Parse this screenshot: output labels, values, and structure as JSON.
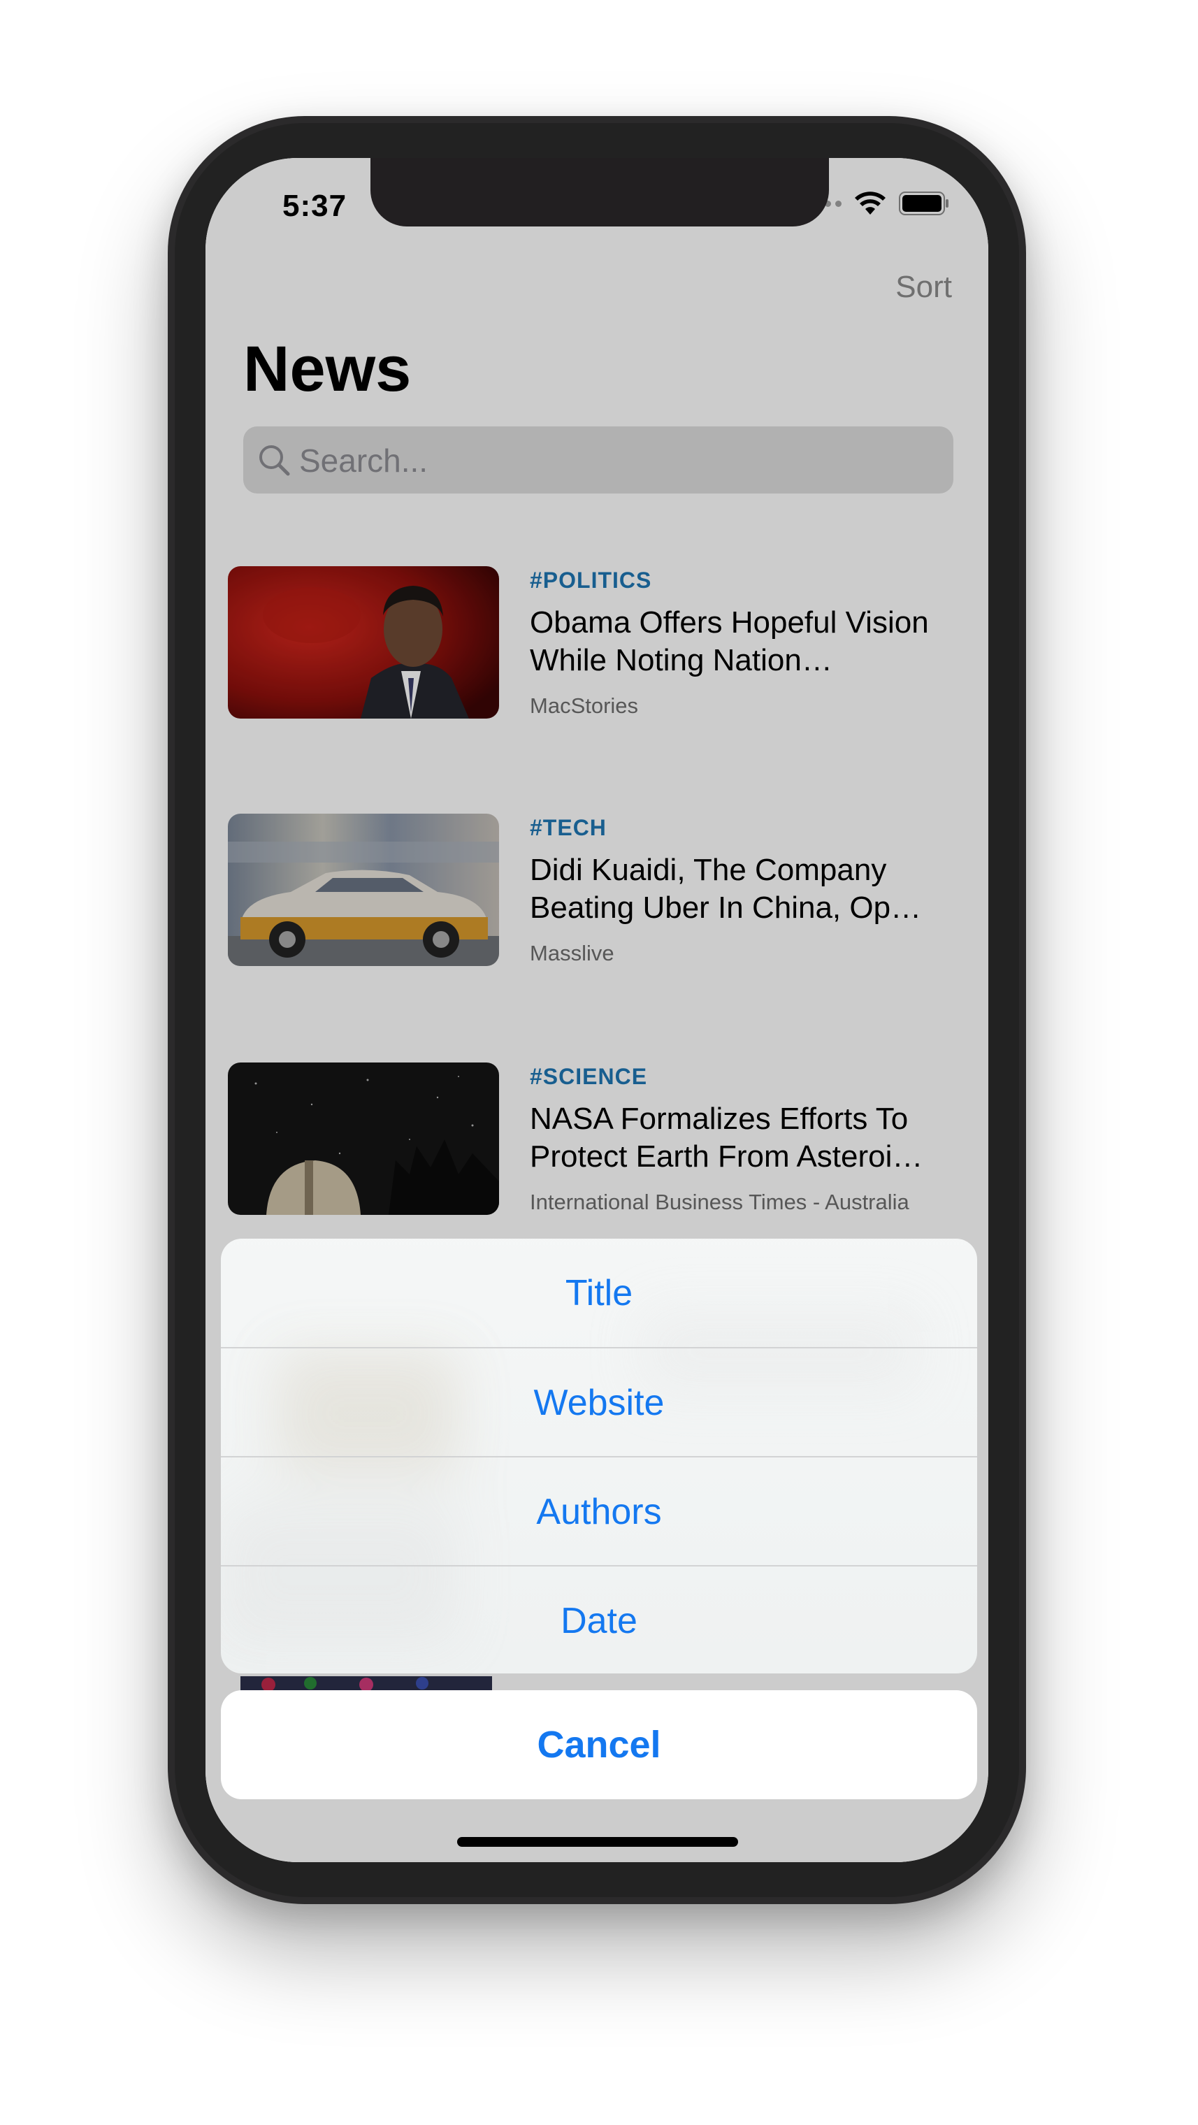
{
  "status_bar": {
    "time": "5:37",
    "icons": [
      "cellular-dots-icon",
      "wifi-icon",
      "battery-icon"
    ]
  },
  "nav": {
    "sort_label": "Sort",
    "title": "News"
  },
  "search": {
    "placeholder": "Search..."
  },
  "articles": [
    {
      "tag": "#POLITICS",
      "headline": "Obama Offers Hopeful Vision While Noting Nation…",
      "source": "MacStories"
    },
    {
      "tag": "#TECH",
      "headline": "Didi Kuaidi, The Company Beating Uber In China, Op…",
      "source": "Masslive"
    },
    {
      "tag": "#SCIENCE",
      "headline": "NASA Formalizes Efforts To Protect Earth From Asteroi…",
      "source": "International Business Times - Australia"
    }
  ],
  "action_sheet": {
    "options": [
      "Title",
      "Website",
      "Authors",
      "Date"
    ],
    "cancel_label": "Cancel"
  },
  "colors": {
    "accent": "#1478f0",
    "tag": "#1f76b3",
    "device_frame": "#2b2a2b"
  }
}
